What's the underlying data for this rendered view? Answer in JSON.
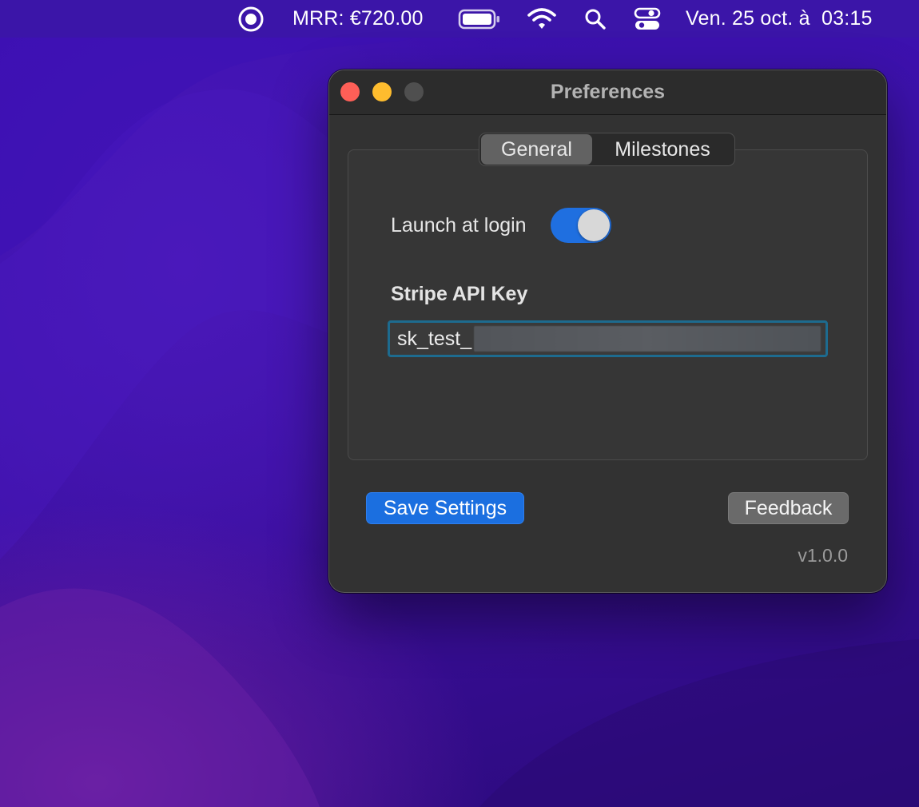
{
  "menubar": {
    "record_icon": "record-circle-icon",
    "mrr_text": "MRR: €720.00",
    "battery_icon": "battery-icon",
    "wifi_icon": "wifi-icon",
    "search_icon": "search-icon",
    "control_center_icon": "control-center-icon",
    "datetime": "Ven. 25 oct. à  03:15"
  },
  "window": {
    "title": "Preferences",
    "tabs": [
      {
        "label": "General",
        "active": true
      },
      {
        "label": "Milestones",
        "active": false
      }
    ],
    "general": {
      "launch_label": "Launch at login",
      "launch_enabled": true,
      "api_key_label": "Stripe API Key",
      "api_key_value": "sk_test_"
    },
    "save_label": "Save Settings",
    "feedback_label": "Feedback",
    "version": "v1.0.0"
  },
  "colors": {
    "accent": "#1b6fe0",
    "close": "#fe5f57",
    "minimize": "#febc2e",
    "desktop": "#3a0fb0"
  }
}
